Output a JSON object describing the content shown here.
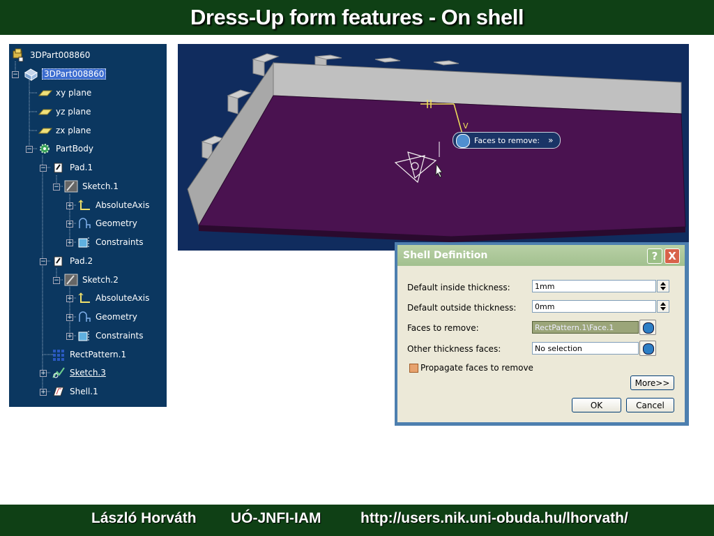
{
  "slide": {
    "title": "Dress-Up form features - On shell",
    "footer": {
      "author": "László Horváth",
      "institute": "UÓ-JNFI-IAM",
      "url": "http://users.nik.uni-obuda.hu/lhorvath/"
    }
  },
  "tree": {
    "root": "3DPart008860",
    "part": "3DPart008860",
    "planes": [
      "xy plane",
      "yz plane",
      "zx plane"
    ],
    "part_body": "PartBody",
    "pad1": "Pad.1",
    "sketch1": "Sketch.1",
    "sketch1_children": [
      "AbsoluteAxis",
      "Geometry",
      "Constraints"
    ],
    "pad2": "Pad.2",
    "sketch2": "Sketch.2",
    "sketch2_children": [
      "AbsoluteAxis",
      "Geometry",
      "Constraints"
    ],
    "rect_pattern": "RectPattern.1",
    "sketch3": "Sketch.3",
    "shell": "Shell.1"
  },
  "viewport": {
    "tooltip": "Faces to remove:",
    "tooltip_arrow": "»",
    "colors": {
      "background": "#102c5e",
      "face": "#4a1250",
      "side": "#b9b9b9"
    }
  },
  "dialog": {
    "title": "Shell Definition",
    "help_button": "?",
    "close_button": "X",
    "inside_thickness_label": "Default inside thickness:",
    "inside_thickness_value": "1mm",
    "outside_thickness_label": "Default outside thickness:",
    "outside_thickness_value": "0mm",
    "faces_to_remove_label": "Faces to remove:",
    "faces_to_remove_value": "RectPattern.1\\Face.1",
    "other_faces_label": "Other thickness faces:",
    "other_faces_value": "No selection",
    "propagate_label": "Propagate faces to remove",
    "more_button": "More>>",
    "ok_button": "OK",
    "cancel_button": "Cancel"
  }
}
